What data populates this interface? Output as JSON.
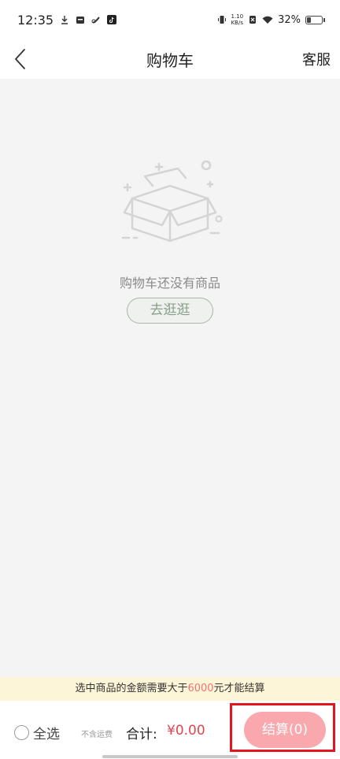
{
  "status_bar": {
    "time": "12:35",
    "net_speed_value": "1.10",
    "net_speed_unit": "KB/s",
    "battery_percent": "32%",
    "battery_level": 0.32,
    "icons": [
      "download-icon",
      "calendar-icon",
      "link-icon",
      "tiktok-icon",
      "vibrate-icon",
      "no-sim-icon",
      "wifi-icon",
      "battery-icon"
    ]
  },
  "nav": {
    "title": "购物车",
    "service_label": "客服",
    "back_icon": "chevron-left-icon"
  },
  "empty_state": {
    "icon": "empty-box-icon",
    "message": "购物车还没有商品",
    "button_label": "去逛逛"
  },
  "notice": {
    "prefix": "选中商品的金额需要大于",
    "amount": "6000",
    "suffix": "元才能结算"
  },
  "bottom_bar": {
    "select_all_label": "全选",
    "shipping_note": "不含运费",
    "total_label": "合计:",
    "total_value": "¥0.00",
    "checkout_label": "结算(0)"
  },
  "colors": {
    "accent_price": "#e8434d",
    "checkout_button": "#f9a9ae",
    "notice_background": "#fcf5d8",
    "highlight_box": "#e2161f"
  }
}
